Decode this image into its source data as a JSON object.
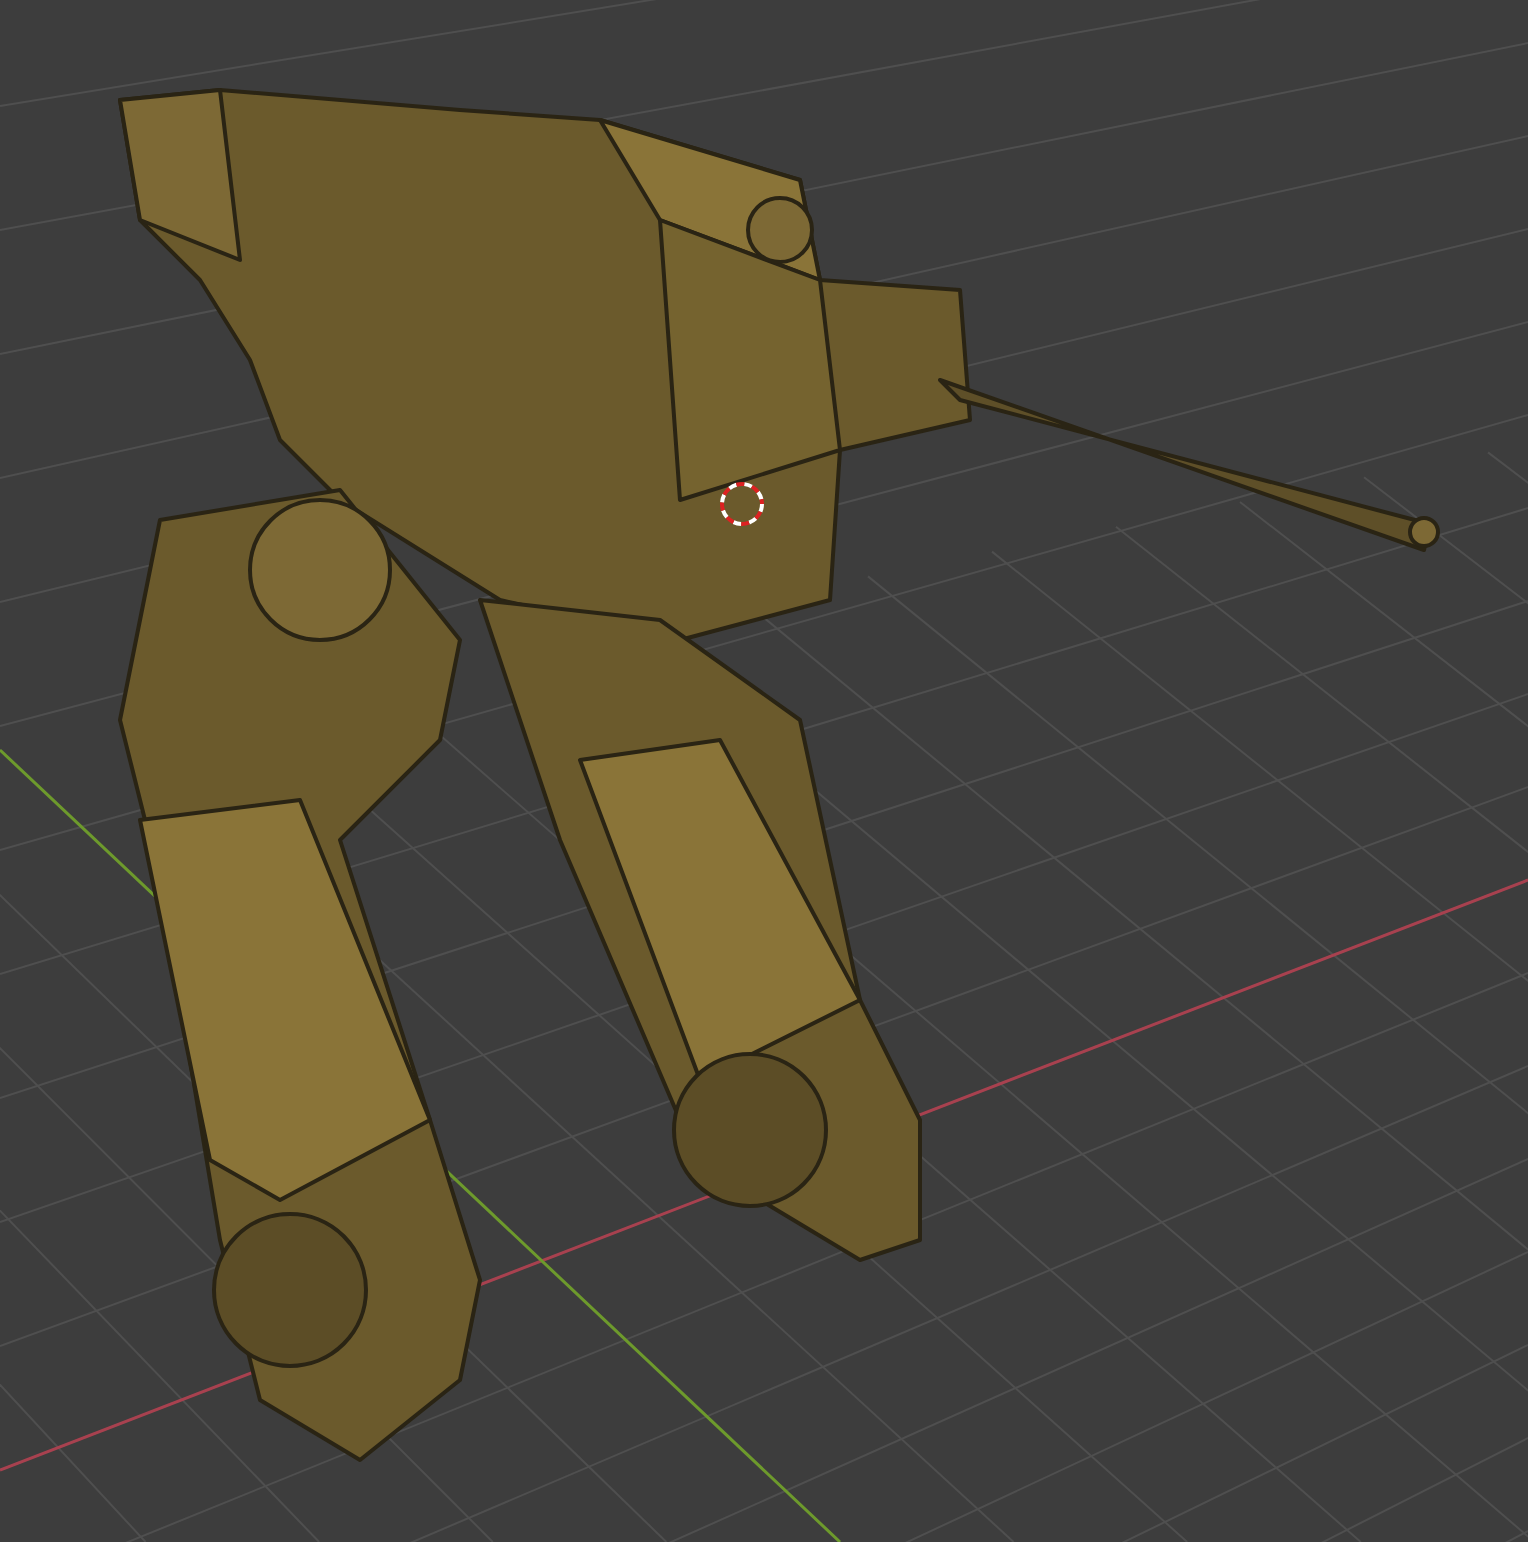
{
  "viewport": {
    "grid": true,
    "axes": [
      {
        "kind": "x",
        "color": "#a8414f"
      },
      {
        "kind": "y",
        "color": "#6d9a2c"
      }
    ],
    "cursor": true
  }
}
